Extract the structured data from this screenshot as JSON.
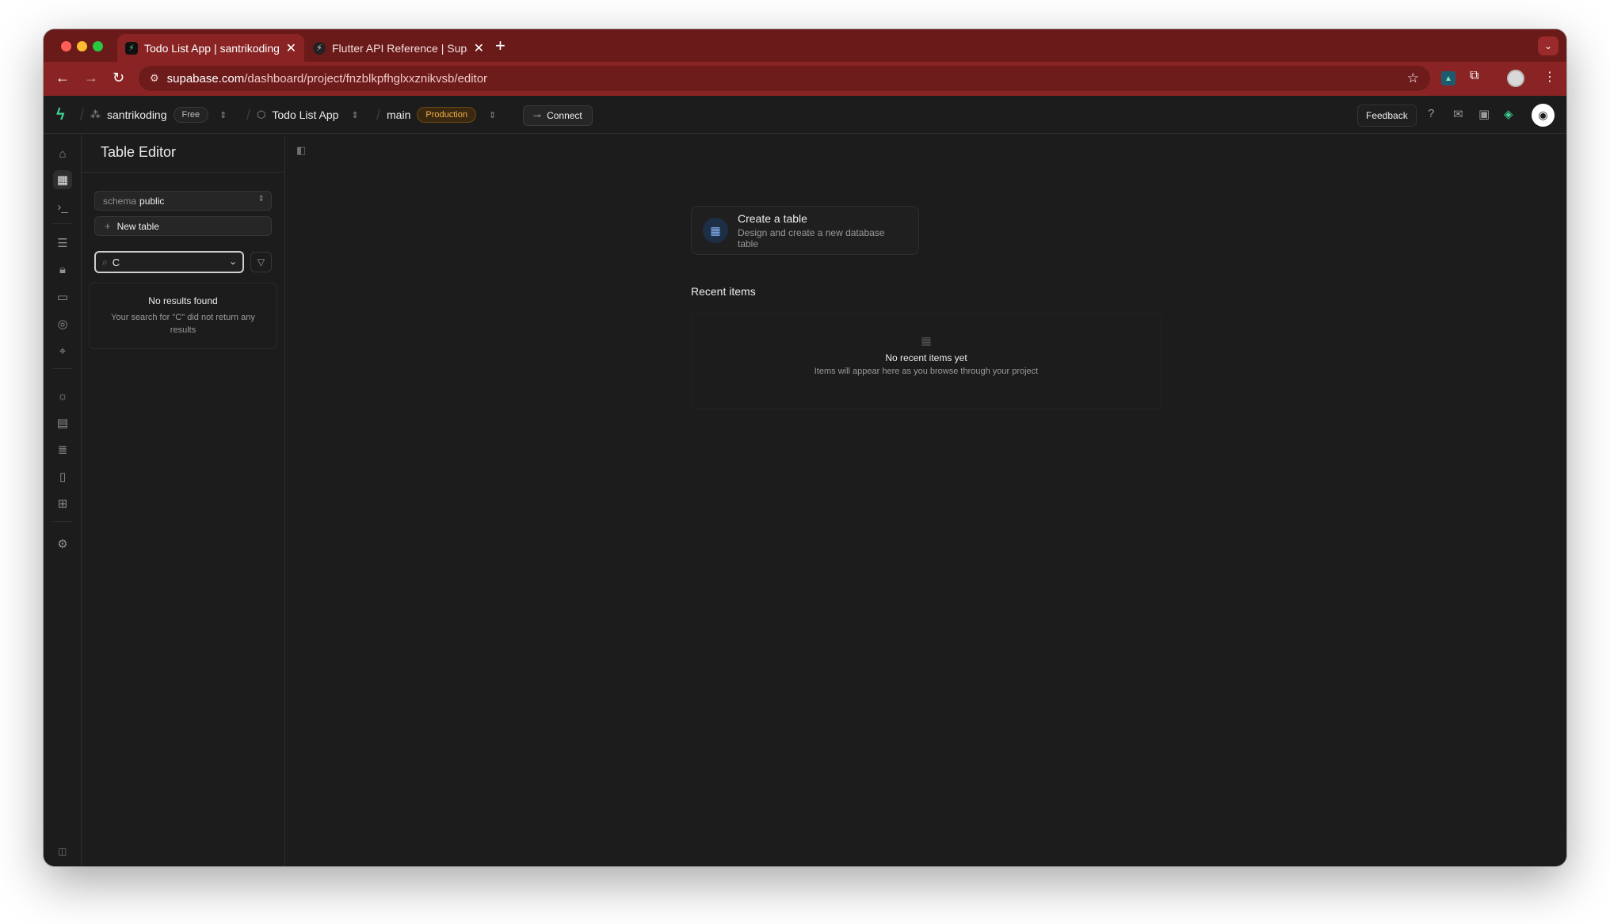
{
  "browser": {
    "tabs": [
      {
        "label": "Todo List App | santrikoding |",
        "active": true,
        "favicon": "supabase-logo"
      },
      {
        "label": "Flutter API Reference | Supab",
        "active": false,
        "favicon": "supabase-logo"
      }
    ],
    "new_tab_glyph": "+",
    "url_host": "supabase.com",
    "url_path": "/dashboard/project/fnzblkpfhglxxznikvsb/editor"
  },
  "appbar": {
    "org_name": "santrikoding",
    "org_plan": "Free",
    "project_name": "Todo List App",
    "branch_name": "main",
    "branch_badge": "Production",
    "connect_label": "Connect",
    "feedback_label": "Feedback"
  },
  "sidebar": {
    "title": "Table Editor",
    "schema_label": "schema",
    "schema_value": "public",
    "new_table_label": "New table",
    "search_value": "C",
    "no_results_title": "No results found",
    "no_results_text": "Your search for \"C\" did not return any results"
  },
  "main": {
    "create_title": "Create a table",
    "create_desc": "Design and create a new database table",
    "recent_title": "Recent items",
    "recent_empty_title": "No recent items yet",
    "recent_empty_text": "Items will appear here as you browse through your project"
  },
  "colors": {
    "browser_frame": "#8a2424",
    "brand_green": "#3ecf8e",
    "production_badge": "#f3b04b",
    "app_background": "#1c1c1c"
  }
}
